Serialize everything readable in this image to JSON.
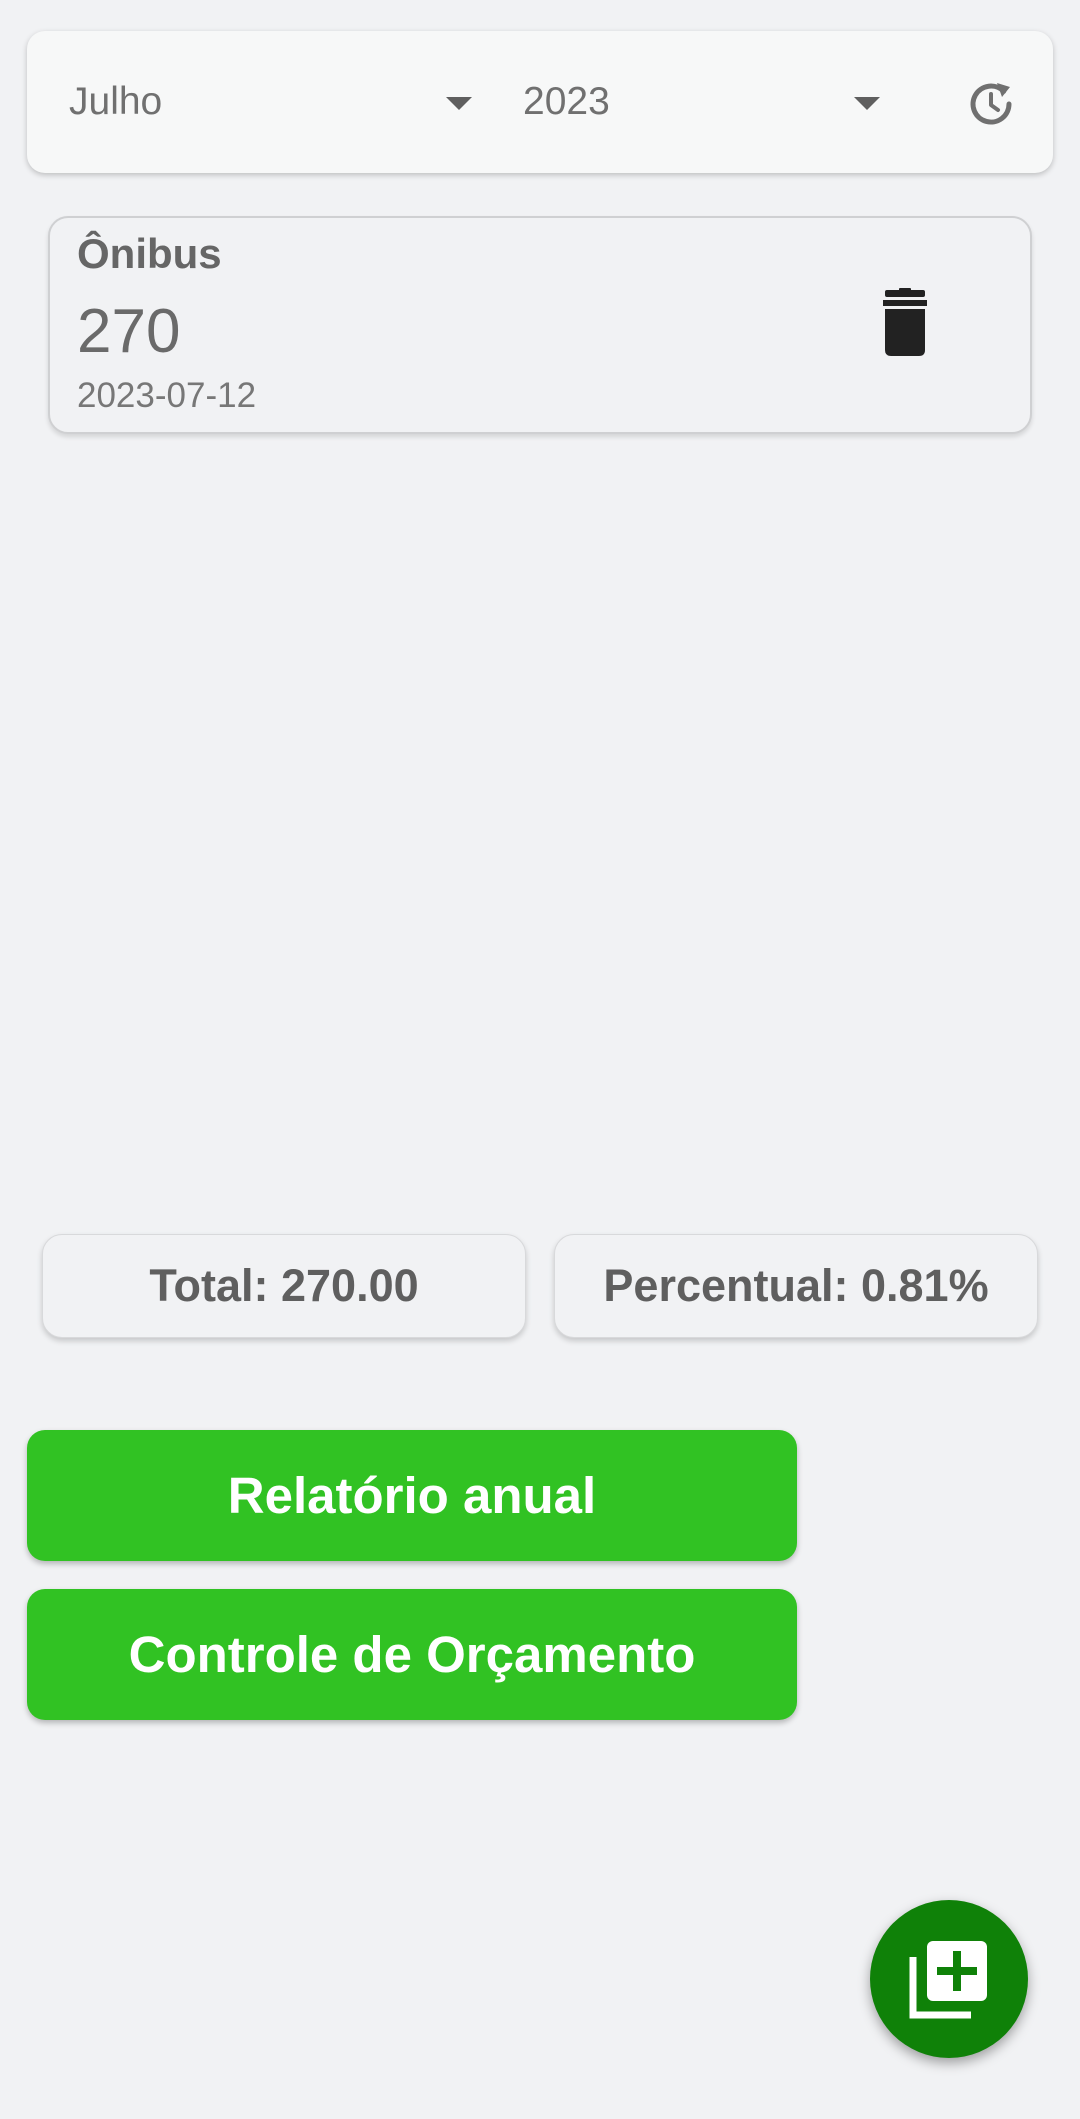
{
  "filters": {
    "month": "Julho",
    "year": "2023",
    "history_icon": "history-icon"
  },
  "expenses": [
    {
      "category": "Ônibus",
      "amount": "270",
      "date": "2023-07-12",
      "delete_icon": "trash-icon"
    }
  ],
  "summary": {
    "total": "Total: 270.00",
    "percent": "Percentual: 0.81%"
  },
  "actions": {
    "annual_report": "Relatório anual",
    "budget_control": "Controle de Orçamento"
  },
  "fab": {
    "icon": "add-library-icon"
  },
  "colors": {
    "accent": "#31c223",
    "fab": "#0f8108",
    "background": "#f1f2f4"
  }
}
